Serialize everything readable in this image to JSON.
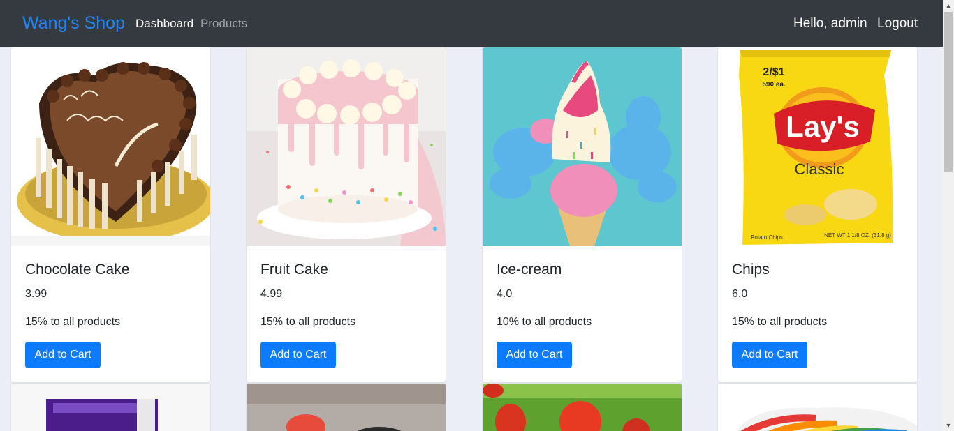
{
  "navbar": {
    "brand": "Wang's Shop",
    "links": [
      "Dashboard",
      "Products"
    ],
    "greeting": "Hello, admin",
    "logout": "Logout"
  },
  "products": [
    {
      "name": "Chocolate Cake",
      "price": "3.99",
      "promo": "15% to all products",
      "button": "Add to Cart",
      "image": "chocolate-cake-image"
    },
    {
      "name": "Fruit Cake",
      "price": "4.99",
      "promo": "15% to all products",
      "button": "Add to Cart",
      "image": "fruit-cake-image"
    },
    {
      "name": "Ice-cream",
      "price": "4.0",
      "promo": "10% to all products",
      "button": "Add to Cart",
      "image": "ice-cream-image"
    },
    {
      "name": "Chips",
      "price": "6.0",
      "promo": "15% to all products",
      "button": "Add to Cart",
      "image": "chips-image"
    }
  ],
  "colors": {
    "navbar_bg": "#343a40",
    "brand": "#1f87ff",
    "button": "#0d7bfe",
    "page_bg": "#ebeef6"
  }
}
